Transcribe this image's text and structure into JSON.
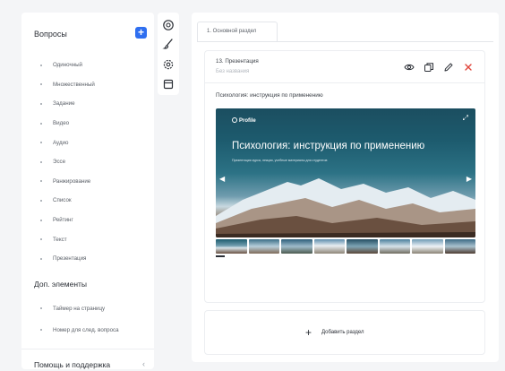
{
  "sidebar": {
    "title": "Вопросы",
    "add_icon": "plus-icon",
    "items": [
      {
        "label": "Одиночный"
      },
      {
        "label": "Множественный"
      },
      {
        "label": "Задание"
      },
      {
        "label": "Видео"
      },
      {
        "label": "Аудио"
      },
      {
        "label": "Эссе"
      },
      {
        "label": "Ранжирование"
      },
      {
        "label": "Список"
      },
      {
        "label": "Рейтинг"
      },
      {
        "label": "Текст"
      },
      {
        "label": "Презентация"
      }
    ],
    "extra_title": "Доп. элементы",
    "extra_items": [
      {
        "label": "Таймер на страницу"
      },
      {
        "label": "Номер для след. вопроса"
      }
    ],
    "help_label": "Помощь и поддержка",
    "help_chevron": "‹"
  },
  "tools": [
    "at-sign-icon",
    "paint-brush-icon",
    "gear-icon",
    "calendar-icon"
  ],
  "main": {
    "tab_label": "1. Основной раздел",
    "card": {
      "title": "13. Презентация",
      "subtitle": "Без названия",
      "actions": [
        "eye-icon",
        "copy-icon",
        "edit-icon",
        "delete-icon"
      ],
      "question": "Психология: инструкция по применению",
      "slide": {
        "logo_text": "Profile",
        "title": "Психология: инструкция по применению",
        "caption": "Презентация курса, лекции, учебные материалы для студентов"
      },
      "thumb_count": 8
    },
    "add_section": {
      "plus": "+",
      "label": "Добавить раздел"
    }
  },
  "colors": {
    "accent": "#2f6ff0",
    "delete": "#e0443a",
    "background": "#f4f5f7"
  }
}
